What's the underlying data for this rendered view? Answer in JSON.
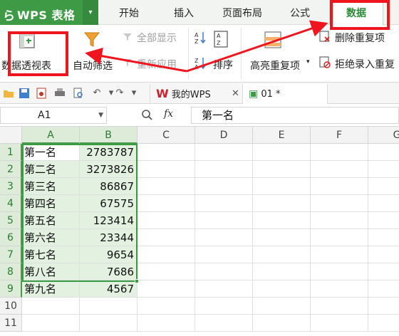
{
  "app": {
    "logo": "ら",
    "name": "WPS 表格",
    "menu_caret": "▾"
  },
  "ribbon_tabs": [
    {
      "label": "开始"
    },
    {
      "label": "插入"
    },
    {
      "label": "页面布局"
    },
    {
      "label": "公式"
    },
    {
      "label": "数据"
    }
  ],
  "ribbon": {
    "pivot_label": "数据透视表",
    "autofilter_label": "自动筛选",
    "show_all_label": "全部显示",
    "reapply_label": "重新应用",
    "sort_label": "排序",
    "highlight_dup_label": "高亮重复项",
    "remove_dup_label": "删除重复项",
    "reject_dup_label": "拒绝录入重复"
  },
  "quick_access": {
    "doc_tab_wps": "我的WPS",
    "doc_tab_file": "01 *"
  },
  "formula_bar": {
    "name_box": "A1",
    "zoom_icon": "🔍",
    "fx": "fx",
    "formula": "第一名"
  },
  "sheet": {
    "columns": [
      "A",
      "B",
      "C",
      "D",
      "E",
      "F",
      "G"
    ],
    "rows": [
      "1",
      "2",
      "3",
      "4",
      "5",
      "6",
      "7",
      "8",
      "9",
      "10",
      "11"
    ],
    "data": [
      {
        "a": "第一名",
        "b": "2783787"
      },
      {
        "a": "第二名",
        "b": "3273826"
      },
      {
        "a": "第三名",
        "b": "86867"
      },
      {
        "a": "第四名",
        "b": "67575"
      },
      {
        "a": "第五名",
        "b": "123414"
      },
      {
        "a": "第六名",
        "b": "23344"
      },
      {
        "a": "第七名",
        "b": "9654"
      },
      {
        "a": "第八名",
        "b": "7686"
      },
      {
        "a": "第九名",
        "b": "4567"
      }
    ]
  },
  "colors": {
    "accent_green": "#3f9a46",
    "annotation_red": "#f0141e"
  }
}
